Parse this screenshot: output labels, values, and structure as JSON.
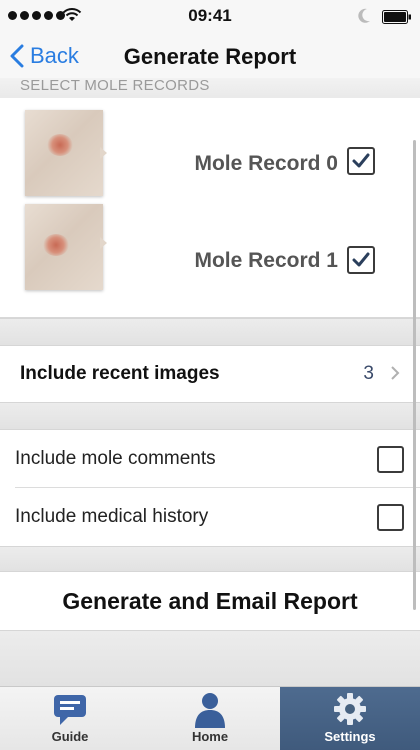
{
  "status_bar": {
    "time": "09:41",
    "icons": [
      "signal-dots",
      "wifi-icon",
      "moon-icon",
      "battery-icon"
    ]
  },
  "nav": {
    "back_label": "Back",
    "title": "Generate Report"
  },
  "section": {
    "header": "SELECT MOLE RECORDS"
  },
  "records": [
    {
      "label": "Mole Record 0",
      "checked": true
    },
    {
      "label": "Mole Record 1",
      "checked": true
    }
  ],
  "recent": {
    "label": "Include recent images",
    "count": "3"
  },
  "options": [
    {
      "label": "Include mole comments",
      "checked": false
    },
    {
      "label": "Include medical history",
      "checked": false
    }
  ],
  "generate_label": "Generate and Email Report",
  "tabs": [
    {
      "label": "Guide",
      "icon": "guide-icon",
      "active": false
    },
    {
      "label": "Home",
      "icon": "home-person-icon",
      "active": false
    },
    {
      "label": "Settings",
      "icon": "gear-icon",
      "active": true
    }
  ],
  "colors": {
    "accent": "#2a7de1",
    "active_tab": "#46617f",
    "label_gray": "#555555"
  }
}
